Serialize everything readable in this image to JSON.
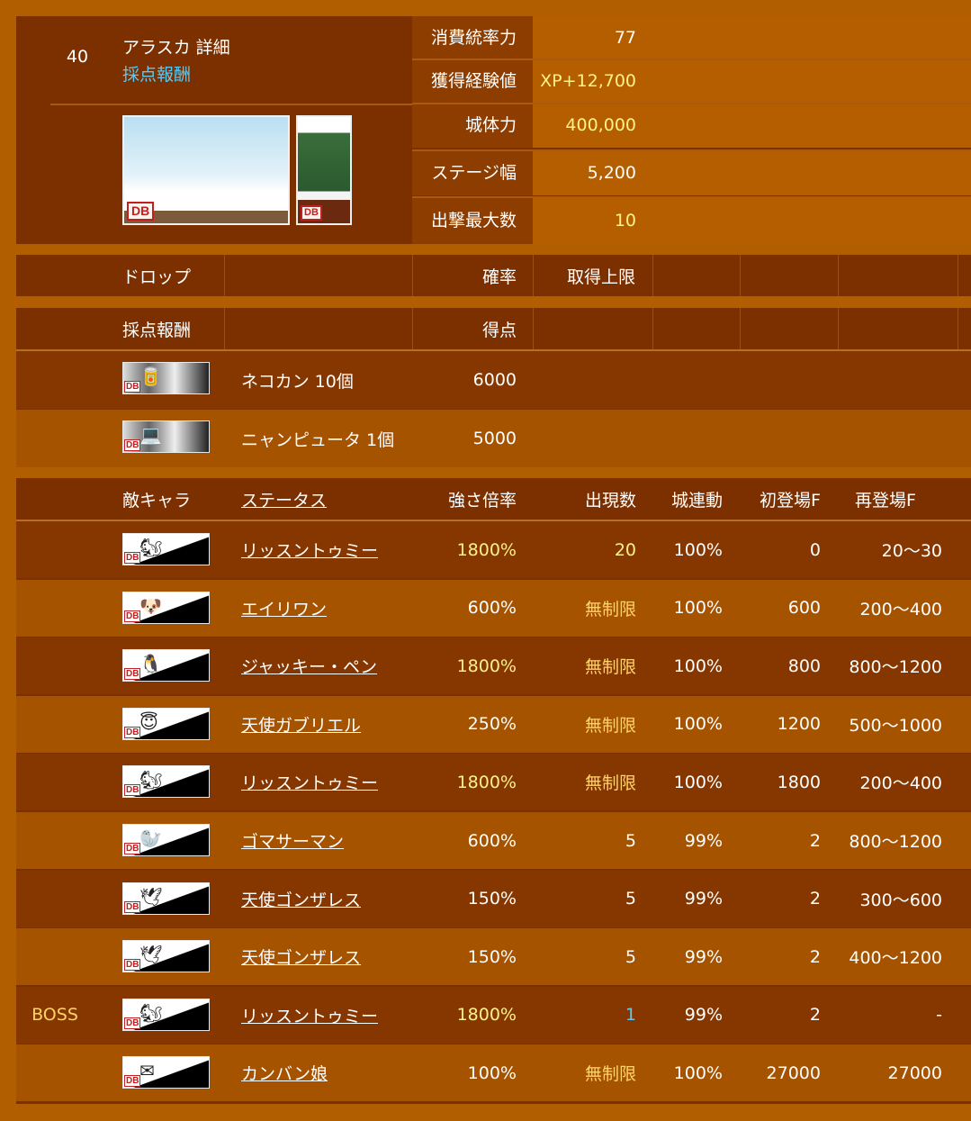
{
  "stage": {
    "number": "40",
    "title": "アラスカ 詳細",
    "reward_link": "採点報酬",
    "bg_badge": "DB",
    "castle_badge": "DB"
  },
  "stats": [
    {
      "label": "消費統率力",
      "value": "77",
      "value_color": "#ffffff"
    },
    {
      "label": "獲得経験値",
      "value": "XP+12,700",
      "value_color": "#fff28a"
    },
    {
      "label": "城体力",
      "value": "400,000",
      "value_color": "#fff28a"
    },
    {
      "label": "ステージ幅",
      "value": "5,200",
      "value_color": "#ffffff"
    },
    {
      "label": "出撃最大数",
      "value": "10",
      "value_color": "#fff28a"
    }
  ],
  "drop": {
    "header": {
      "item": "ドロップ",
      "rate": "確率",
      "limit": "取得上限"
    }
  },
  "score_rewards": {
    "header": {
      "name": "採点報酬",
      "score": "得点"
    },
    "rows": [
      {
        "icon": "neko-can-icon",
        "badge": "DB",
        "name": "ネコカン 10個",
        "score": "6000"
      },
      {
        "icon": "nyanputer-icon",
        "badge": "DB",
        "name": "ニャンピュータ 1個",
        "score": "5000"
      }
    ]
  },
  "enemies": {
    "header": {
      "enemy": "敵キャラ",
      "status": "ステータス",
      "magnification": "強さ倍率",
      "count": "出現数",
      "castle_link": "城連動",
      "first_frame": "初登場F",
      "respawn_frame": "再登場F"
    },
    "rows": [
      {
        "boss": "",
        "icon": "squirrel-enemy-icon",
        "name": "リッスントゥミー",
        "mag": "1800%",
        "mag_color": "#fff28a",
        "count": "20",
        "count_color": "#fff28a",
        "castle": "100%",
        "first": "0",
        "respawn": "20～30"
      },
      {
        "boss": "",
        "icon": "alien-dog-enemy-icon",
        "name": "エイリワン",
        "mag": "600%",
        "mag_color": "#ffffff",
        "count": "無制限",
        "count_color": "#ffd26a",
        "castle": "100%",
        "first": "600",
        "respawn": "200～400"
      },
      {
        "boss": "",
        "icon": "penguin-enemy-icon",
        "name": "ジャッキー・ペン",
        "mag": "1800%",
        "mag_color": "#fff28a",
        "count": "無制限",
        "count_color": "#ffd26a",
        "castle": "100%",
        "first": "800",
        "respawn": "800～1200"
      },
      {
        "boss": "",
        "icon": "angel-dog-enemy-icon",
        "name": "天使ガブリエル",
        "mag": "250%",
        "mag_color": "#ffffff",
        "count": "無制限",
        "count_color": "#ffd26a",
        "castle": "100%",
        "first": "1200",
        "respawn": "500～1000"
      },
      {
        "boss": "",
        "icon": "squirrel-enemy-icon",
        "name": "リッスントゥミー",
        "mag": "1800%",
        "mag_color": "#fff28a",
        "count": "無制限",
        "count_color": "#ffd26a",
        "castle": "100%",
        "first": "1800",
        "respawn": "200～400"
      },
      {
        "boss": "",
        "icon": "seal-enemy-icon",
        "name": "ゴマサーマン",
        "mag": "600%",
        "mag_color": "#ffffff",
        "count": "5",
        "count_color": "#ffffff",
        "castle": "99%",
        "first": "2",
        "respawn": "800～1200"
      },
      {
        "boss": "",
        "icon": "angel-bird-enemy-icon",
        "name": "天使ゴンザレス",
        "mag": "150%",
        "mag_color": "#ffffff",
        "count": "5",
        "count_color": "#ffffff",
        "castle": "99%",
        "first": "2",
        "respawn": "300～600"
      },
      {
        "boss": "",
        "icon": "angel-bird-enemy-icon",
        "name": "天使ゴンザレス",
        "mag": "150%",
        "mag_color": "#ffffff",
        "count": "5",
        "count_color": "#ffffff",
        "castle": "99%",
        "first": "2",
        "respawn": "400～1200"
      },
      {
        "boss": "BOSS",
        "icon": "squirrel-enemy-icon",
        "name": "リッスントゥミー",
        "mag": "1800%",
        "mag_color": "#fff28a",
        "count": "1",
        "count_color": "#5ec8f0",
        "castle": "99%",
        "first": "2",
        "respawn": "-"
      },
      {
        "boss": "",
        "icon": "signboard-girl-enemy-icon",
        "name": "カンバン娘",
        "mag": "100%",
        "mag_color": "#ffffff",
        "count": "無制限",
        "count_color": "#ffd26a",
        "castle": "100%",
        "first": "27000",
        "respawn": "27000"
      }
    ]
  },
  "colors": {
    "page_bg": "#b05e00",
    "panel_dark": "#7c3000",
    "row_dark": "#863700",
    "row_light": "#a65300",
    "highlight_yellow": "#fff28a",
    "unlimited_orange": "#ffd26a",
    "link_cyan": "#5ec8f0",
    "boss_label": "#ffd26a"
  }
}
